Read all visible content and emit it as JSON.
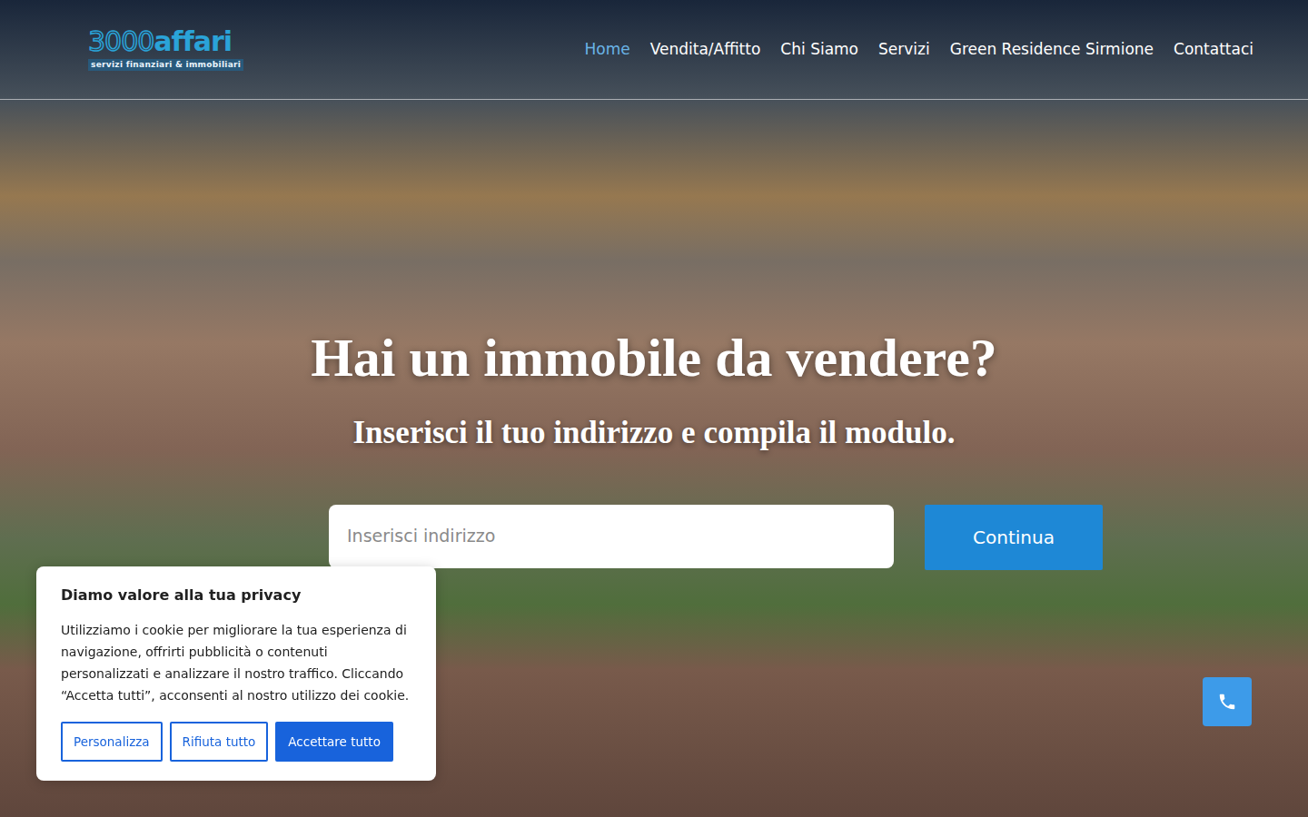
{
  "logo": {
    "number": "3000",
    "word": "affari",
    "tagline": "servizi finanziari & immobiliari"
  },
  "nav": [
    {
      "label": "Home",
      "selected": true
    },
    {
      "label": "Vendita/Affitto",
      "selected": false
    },
    {
      "label": "Chi Siamo",
      "selected": false
    },
    {
      "label": "Servizi",
      "selected": false
    },
    {
      "label": "Green Residence Sirmione",
      "selected": false
    },
    {
      "label": "Contattaci",
      "selected": false
    }
  ],
  "hero": {
    "title": "Hai un immobile da vendere?",
    "subtitle": "Inserisci il tuo indirizzo e compila il modulo."
  },
  "search": {
    "placeholder": "Inserisci indirizzo",
    "button": "Continua"
  },
  "cookie": {
    "title": "Diamo valore alla tua privacy",
    "text": "Utilizziamo i cookie per migliorare la tua esperienza di navigazione, offrirti pubblicità o contenuti personalizzati e analizzare il nostro traffico. Cliccando “Accetta tutti”, acconsenti al nostro utilizzo dei cookie.",
    "buttons": [
      {
        "label": "Personalizza",
        "kind": "outline"
      },
      {
        "label": "Rifiuta tutto",
        "kind": "outline"
      },
      {
        "label": "Accettare tutto",
        "kind": "solid"
      }
    ]
  }
}
